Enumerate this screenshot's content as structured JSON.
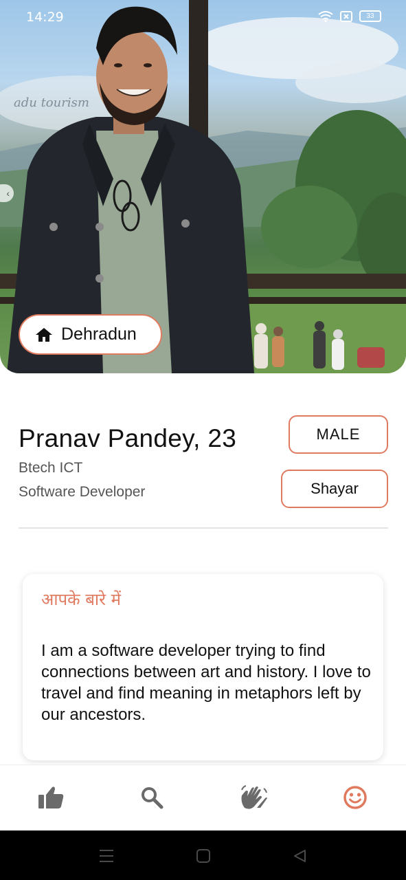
{
  "status_bar": {
    "time": "14:29",
    "battery": "33",
    "icons": [
      "wifi-icon",
      "sim-icon",
      "battery-icon"
    ]
  },
  "profile": {
    "location": "Dehradun",
    "location_icon": "home-icon",
    "name_age": "Pranav Pandey, 23",
    "education": "Btech ICT",
    "occupation": "Software Developer",
    "gender_tag": "MALE",
    "hobby_tag": "Shayar"
  },
  "about": {
    "heading": "आपके बारे में",
    "text": "I am a software developer trying to find connections between art and history. I love to travel and find meaning in metaphors left by our ancestors."
  },
  "bottom_nav": {
    "items": [
      {
        "icon": "thumbs-up-icon",
        "active": false
      },
      {
        "icon": "search-icon",
        "active": false
      },
      {
        "icon": "wave-hands-icon",
        "active": false
      },
      {
        "icon": "smiley-profile-icon",
        "active": true
      }
    ]
  },
  "colors": {
    "accent": "#e07a5f",
    "nav_inactive": "#6a6a6a",
    "system_bar": "#000000"
  }
}
